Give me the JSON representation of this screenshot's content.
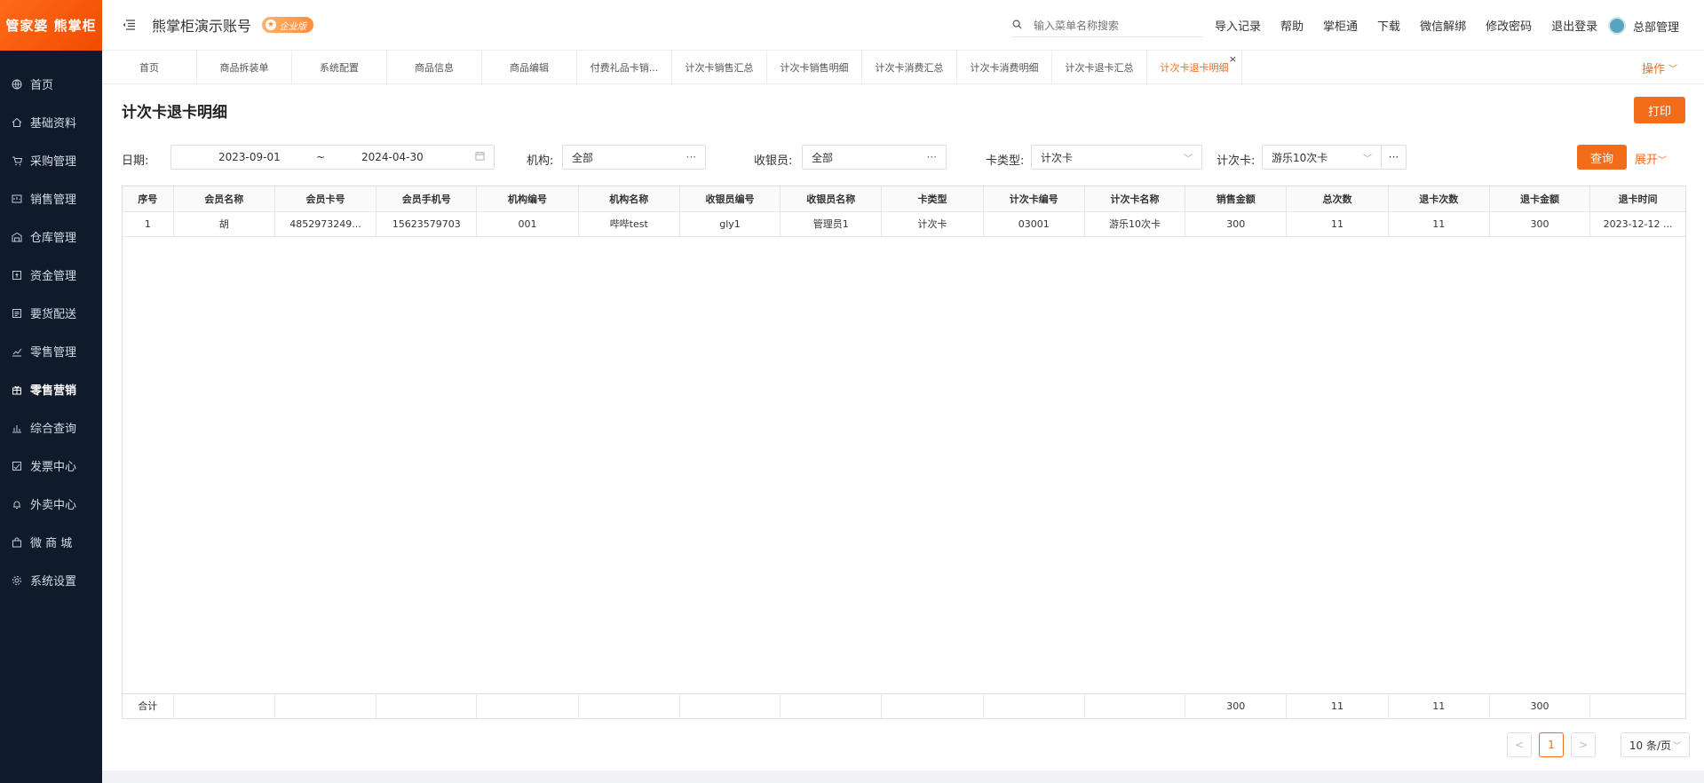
{
  "sidebar": {
    "logo": "管家婆 熊掌柜",
    "items": [
      {
        "label": "首页",
        "icon": "globe-icon"
      },
      {
        "label": "基础资料",
        "icon": "home-icon"
      },
      {
        "label": "采购管理",
        "icon": "cart-icon"
      },
      {
        "label": "销售管理",
        "icon": "sales-icon"
      },
      {
        "label": "仓库管理",
        "icon": "warehouse-icon"
      },
      {
        "label": "资金管理",
        "icon": "money-icon"
      },
      {
        "label": "要货配送",
        "icon": "delivery-icon"
      },
      {
        "label": "零售管理",
        "icon": "chart-icon"
      },
      {
        "label": "零售营销",
        "icon": "gift-icon"
      },
      {
        "label": "综合查询",
        "icon": "bar-chart-icon"
      },
      {
        "label": "发票中心",
        "icon": "invoice-icon"
      },
      {
        "label": "外卖中心",
        "icon": "bell-icon"
      },
      {
        "label": "微 商 城",
        "icon": "bag-icon"
      },
      {
        "label": "系统设置",
        "icon": "gear-icon"
      }
    ],
    "active_index": 8
  },
  "header": {
    "account": "熊掌柜演示账号",
    "badge": "企业版",
    "search_placeholder": "输入菜单名称搜索",
    "links": [
      "导入记录",
      "帮助",
      "掌柜通",
      "下载",
      "微信解绑",
      "修改密码",
      "退出登录"
    ],
    "user": "总部管理"
  },
  "tabs": {
    "items": [
      "首页",
      "商品拆装单",
      "系统配置",
      "商品信息",
      "商品编辑",
      "付费礼品卡销...",
      "计次卡销售汇总",
      "计次卡销售明细",
      "计次卡消费汇总",
      "计次卡消费明细",
      "计次卡退卡汇总",
      "计次卡退卡明细"
    ],
    "active_index": 11,
    "close": "×",
    "ops": "操作"
  },
  "page": {
    "title": "计次卡退卡明细",
    "print": "打印"
  },
  "filters": {
    "date_label": "日期:",
    "date_from": "2023-09-01",
    "date_sep": "~",
    "date_to": "2024-04-30",
    "org_label": "机构:",
    "org_value": "全部",
    "cashier_label": "收银员:",
    "cashier_value": "全部",
    "cardtype_label": "卡类型:",
    "cardtype_value": "计次卡",
    "card_label": "计次卡:",
    "card_value": "游乐10次卡",
    "query": "查询",
    "expand": "展开"
  },
  "table": {
    "headers": [
      "序号",
      "会员名称",
      "会员卡号",
      "会员手机号",
      "机构编号",
      "机构名称",
      "收银员编号",
      "收银员名称",
      "卡类型",
      "计次卡编号",
      "计次卡名称",
      "销售金额",
      "总次数",
      "退卡次数",
      "退卡金额",
      "退卡时间"
    ],
    "rows": [
      [
        "1",
        "胡",
        "4852973249...",
        "15623579703",
        "001",
        "哔哔test",
        "gly1",
        "管理员1",
        "计次卡",
        "03001",
        "游乐10次卡",
        "300",
        "11",
        "11",
        "300",
        "2023-12-12 ..."
      ]
    ],
    "total": [
      "合计",
      "",
      "",
      "",
      "",
      "",
      "",
      "",
      "",
      "",
      "",
      "300",
      "11",
      "11",
      "300",
      ""
    ]
  },
  "pager": {
    "prev": "<",
    "current": "1",
    "next": ">",
    "page_size": "10 条/页"
  }
}
